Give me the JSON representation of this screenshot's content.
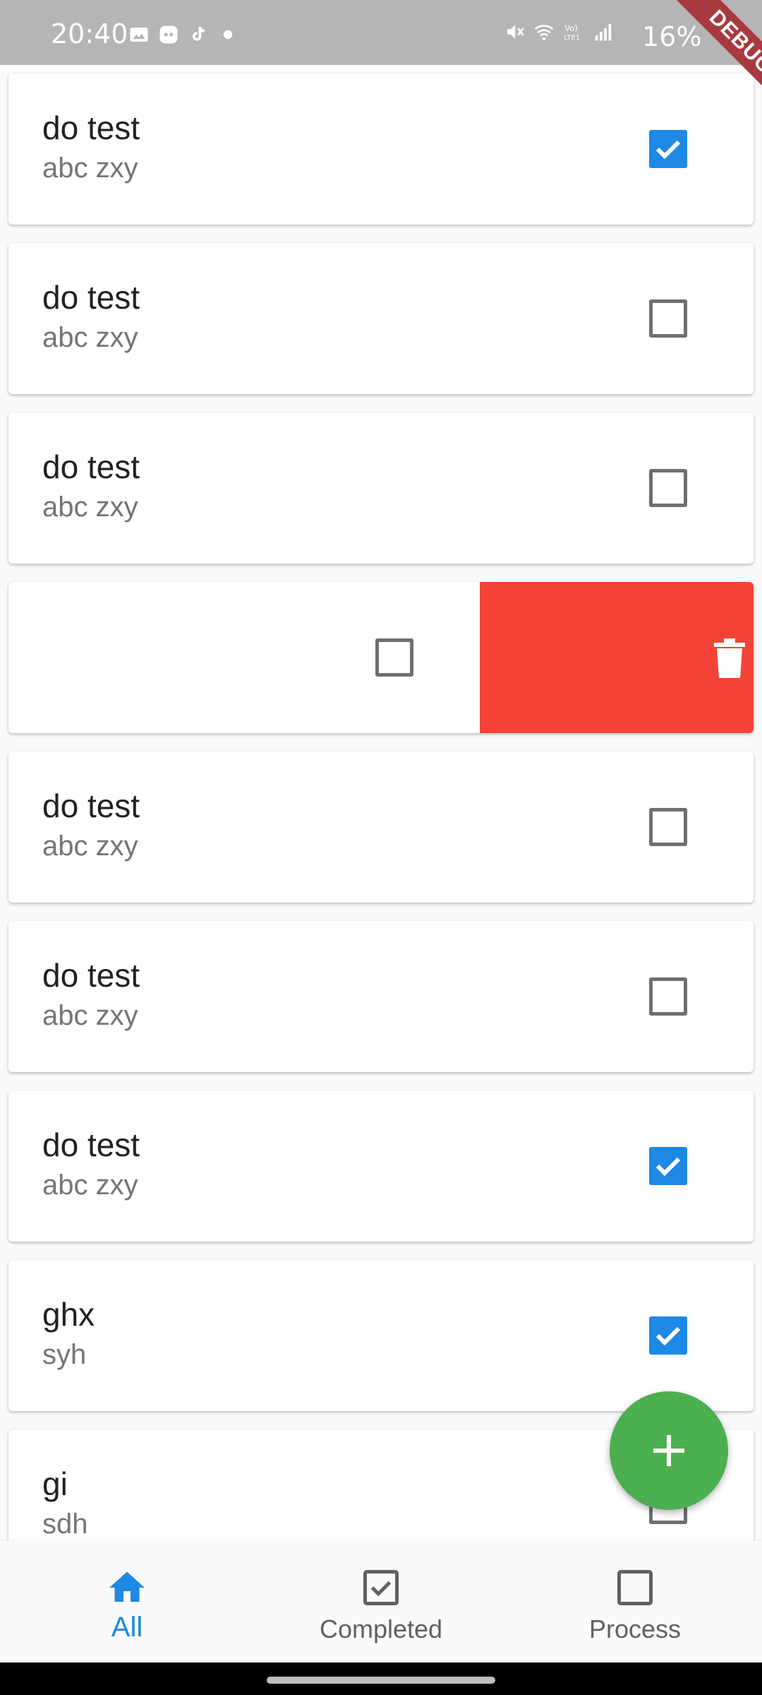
{
  "status_bar": {
    "time": "20:40",
    "battery": "16%",
    "left_icons": [
      "image-icon",
      "game-icon",
      "tiktok-icon",
      "dot-icon"
    ],
    "right_icons": [
      "mute-icon",
      "wifi-icon",
      "volte-icon",
      "signal-icon"
    ]
  },
  "debug_banner": "DEBUG",
  "todos": [
    {
      "title": "do test",
      "subtitle": "abc zxy",
      "checked": true
    },
    {
      "title": "do test",
      "subtitle": "abc zxy",
      "checked": false
    },
    {
      "title": "do test",
      "subtitle": "abc zxy",
      "checked": false
    },
    {
      "title": "",
      "subtitle": "",
      "checked": false,
      "swiped": true,
      "action_icon": "trash-icon",
      "action_color": "#f44336"
    },
    {
      "title": "do test",
      "subtitle": "abc zxy",
      "checked": false
    },
    {
      "title": "do test",
      "subtitle": "abc zxy",
      "checked": false
    },
    {
      "title": "do test",
      "subtitle": "abc zxy",
      "checked": true
    },
    {
      "title": "ghx",
      "subtitle": "syh",
      "checked": true
    },
    {
      "title": "gi",
      "subtitle": "sdh",
      "checked": false
    }
  ],
  "fab": {
    "icon": "plus-icon",
    "color": "#4caf50"
  },
  "bottom_nav": [
    {
      "label": "All",
      "icon": "home-icon",
      "active": true
    },
    {
      "label": "Completed",
      "icon": "checkbox-checked-icon",
      "active": false
    },
    {
      "label": "Process",
      "icon": "checkbox-empty-icon",
      "active": false
    }
  ],
  "colors": {
    "accent": "#1e88e5",
    "delete": "#f44336",
    "fab": "#4caf50"
  }
}
